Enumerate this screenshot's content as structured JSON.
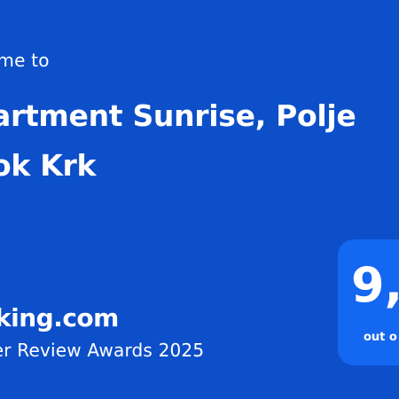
{
  "card": {
    "welcome_text": "ome to",
    "property_name_line1": "artment Sunrise, Polje",
    "property_name_line2": "ok Krk",
    "brand": "king.com",
    "award_text": "ler Review Awards 2025",
    "score": "9,",
    "score_suffix": "out o"
  },
  "colors": {
    "background": "#0d4fc9",
    "score_box": "#1467f0",
    "text": "#ffffff"
  }
}
